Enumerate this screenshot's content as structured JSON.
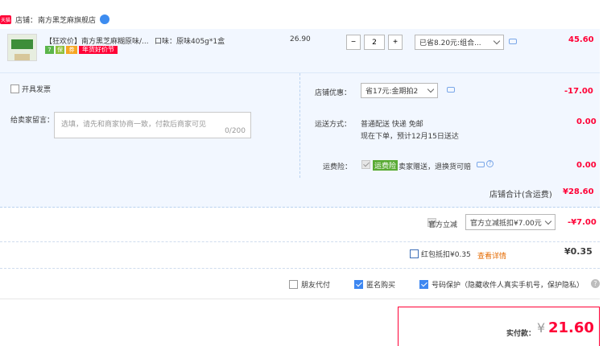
{
  "shop": {
    "tag": "天猫",
    "label": "店铺：",
    "name": "南方黑芝麻旗舰店"
  },
  "item": {
    "title": "【狂欢价】南方黑芝麻糊原味/...",
    "badges": [
      "7",
      "保",
      "券"
    ],
    "promo": "年货好价节",
    "sku": "口味：原味405g*1盒",
    "price": "26.90",
    "qty": "2",
    "minus": "−",
    "plus": "+",
    "discount": "已省8.20元:组合...",
    "subtotal": "45.60"
  },
  "invoice": {
    "label": "开具发票"
  },
  "message": {
    "label": "给卖家留言：",
    "placeholder": "选填，请先和商家协商一致，付款后商家可见",
    "counter": "0/200"
  },
  "shop_discount": {
    "label": "店铺优惠：",
    "selected": "省17元:金期拍2",
    "amount": "-17.00"
  },
  "delivery": {
    "label": "运送方式：",
    "line1": "普通配送 快递 免邮",
    "line2": "现在下单，预计12月15日送达",
    "amount": "0.00"
  },
  "insurance": {
    "label": "运费险：",
    "tag": "运费险",
    "text": "卖家赠送，退换货可赔",
    "amount": "0.00"
  },
  "shop_total": {
    "label": "店铺合计(含运费)",
    "amount": "¥28.60"
  },
  "official": {
    "label": "官方立减",
    "selected": "官方立减抵扣¥7.00元",
    "amount": "-¥7.00"
  },
  "red_packet": {
    "label": "红包抵扣¥0.35",
    "link": "查看详情",
    "amount": "¥0.35"
  },
  "options": {
    "friend_pay": "朋友代付",
    "anonymous": "匿名购买",
    "number_protect": "号码保护（隐藏收件人真实手机号，保护隐私）",
    "help": "?"
  },
  "payment": {
    "label": "实付款：",
    "currency": "¥",
    "amount": "21.60"
  },
  "colors": {
    "accent": "#ff0036",
    "panel": "#f2f7ff",
    "border": "#b9d2f0"
  }
}
